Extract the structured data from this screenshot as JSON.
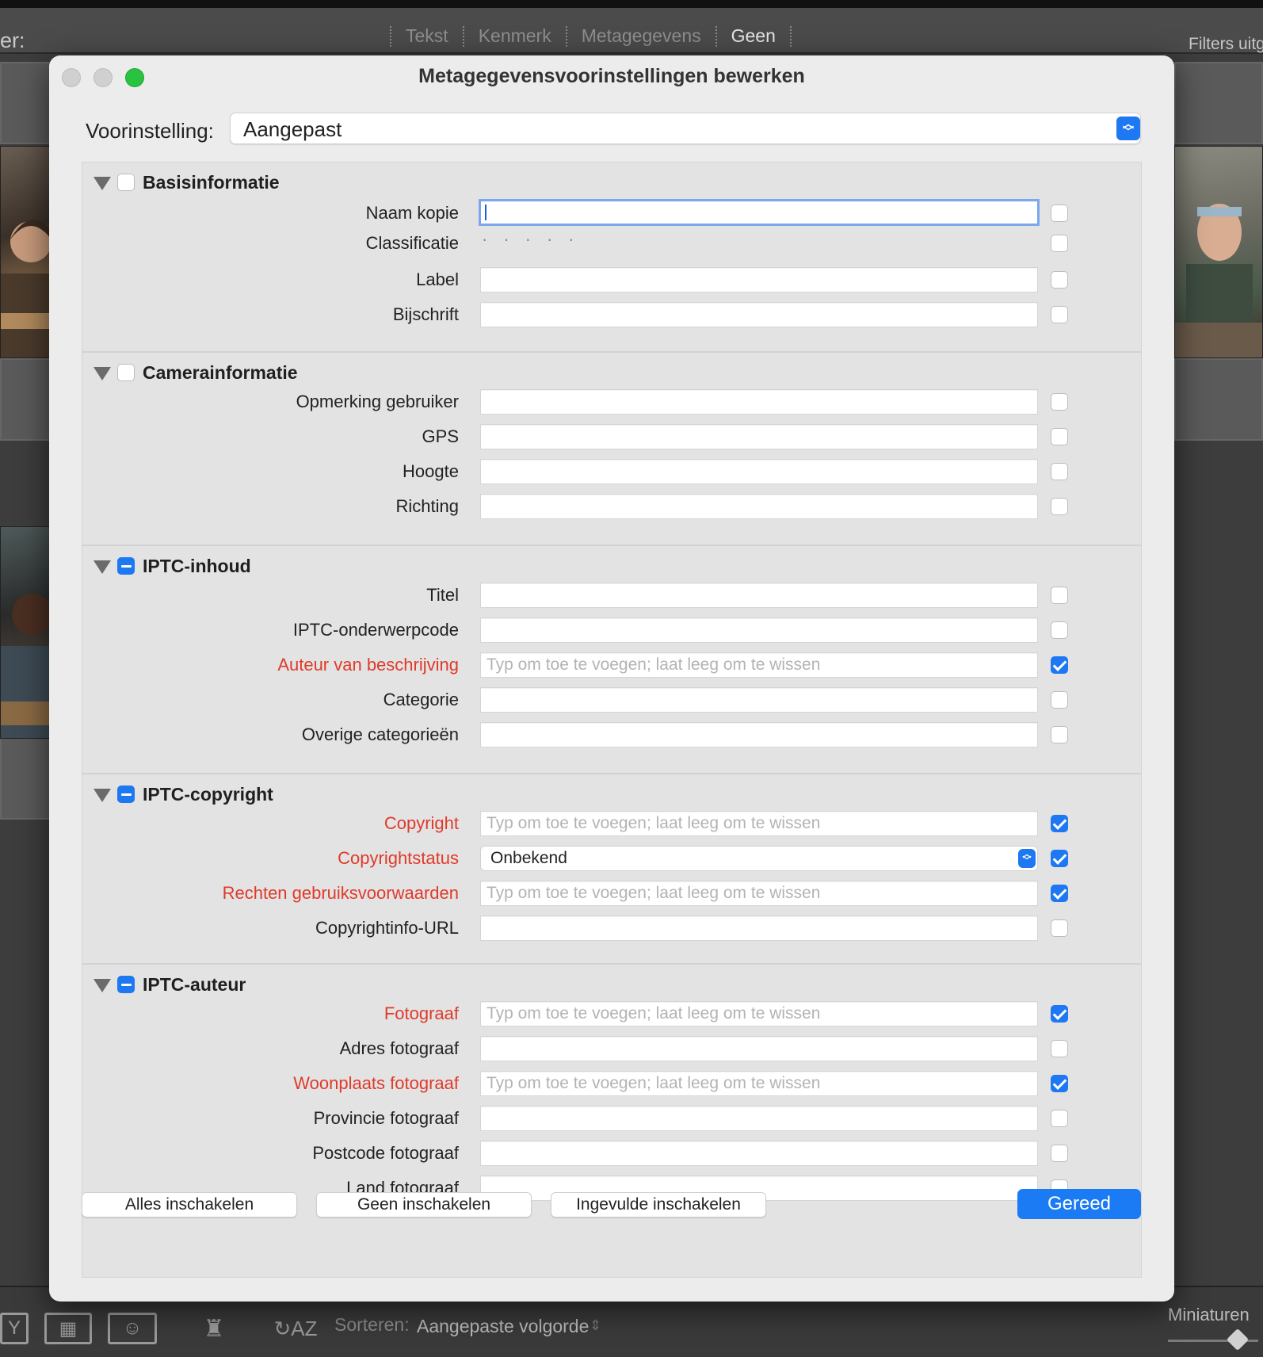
{
  "background": {
    "filter_label": "er:",
    "filter_tabs": [
      "Tekst",
      "Kenmerk",
      "Metagegevens",
      "Geen"
    ],
    "filters_off": "Filters uitg",
    "sort_label": "Sorteren:",
    "sort_value": "Aangepaste volgorde",
    "thumbnails_label": "Miniaturen"
  },
  "dialog": {
    "title": "Metagegevensvoorinstellingen bewerken",
    "preset_label": "Voorinstelling:",
    "preset_value": "Aangepast",
    "placeholder": "Typ om toe te voegen; laat leeg om te wissen",
    "groups": [
      {
        "title": "Basisinformatie",
        "state": "unchecked",
        "rows": [
          {
            "label": "Naam kopie",
            "type": "text",
            "focused": true,
            "checked": false
          },
          {
            "label": "Classificatie",
            "type": "rating",
            "checked": false
          },
          {
            "label": "Label",
            "type": "text",
            "checked": false
          },
          {
            "label": "Bijschrift",
            "type": "text",
            "checked": false
          }
        ]
      },
      {
        "title": "Camerainformatie",
        "state": "unchecked",
        "rows": [
          {
            "label": "Opmerking gebruiker",
            "type": "text",
            "checked": false
          },
          {
            "label": "GPS",
            "type": "text",
            "checked": false
          },
          {
            "label": "Hoogte",
            "type": "text",
            "checked": false
          },
          {
            "label": "Richting",
            "type": "text",
            "checked": false
          }
        ]
      },
      {
        "title": "IPTC-inhoud",
        "state": "mixed",
        "rows": [
          {
            "label": "Titel",
            "type": "text",
            "checked": false
          },
          {
            "label": "IPTC-onderwerpcode",
            "type": "text",
            "checked": false
          },
          {
            "label": "Auteur van beschrijving",
            "type": "text",
            "checked": true,
            "red": true
          },
          {
            "label": "Categorie",
            "type": "text",
            "checked": false
          },
          {
            "label": "Overige categorieën",
            "type": "text",
            "checked": false
          }
        ]
      },
      {
        "title": "IPTC-copyright",
        "state": "mixed",
        "rows": [
          {
            "label": "Copyright",
            "type": "text",
            "checked": true,
            "red": true
          },
          {
            "label": "Copyrightstatus",
            "type": "select",
            "value": "Onbekend",
            "checked": true,
            "red": true
          },
          {
            "label": "Rechten gebruiksvoorwaarden",
            "type": "text",
            "checked": true,
            "red": true
          },
          {
            "label": "Copyrightinfo-URL",
            "type": "text",
            "checked": false
          }
        ]
      },
      {
        "title": "IPTC-auteur",
        "state": "mixed",
        "rows": [
          {
            "label": "Fotograaf",
            "type": "text",
            "checked": true,
            "red": true
          },
          {
            "label": "Adres fotograaf",
            "type": "text",
            "checked": false
          },
          {
            "label": "Woonplaats fotograaf",
            "type": "text",
            "checked": true,
            "red": true
          },
          {
            "label": "Provincie fotograaf",
            "type": "text",
            "checked": false
          },
          {
            "label": "Postcode fotograaf",
            "type": "text",
            "checked": false
          },
          {
            "label": "Land fotograaf",
            "type": "text",
            "checked": false
          }
        ]
      }
    ],
    "buttons": {
      "enable_all": "Alles inschakelen",
      "enable_none": "Geen inschakelen",
      "enable_filled": "Ingevulde inschakelen",
      "done": "Gereed"
    }
  },
  "colors": {
    "accent": "#1e78f2",
    "required_label": "#e03a2a",
    "traffic_close": "#d0d0d0",
    "traffic_min": "#d0d0d0",
    "traffic_zoom": "#2ac33f"
  }
}
